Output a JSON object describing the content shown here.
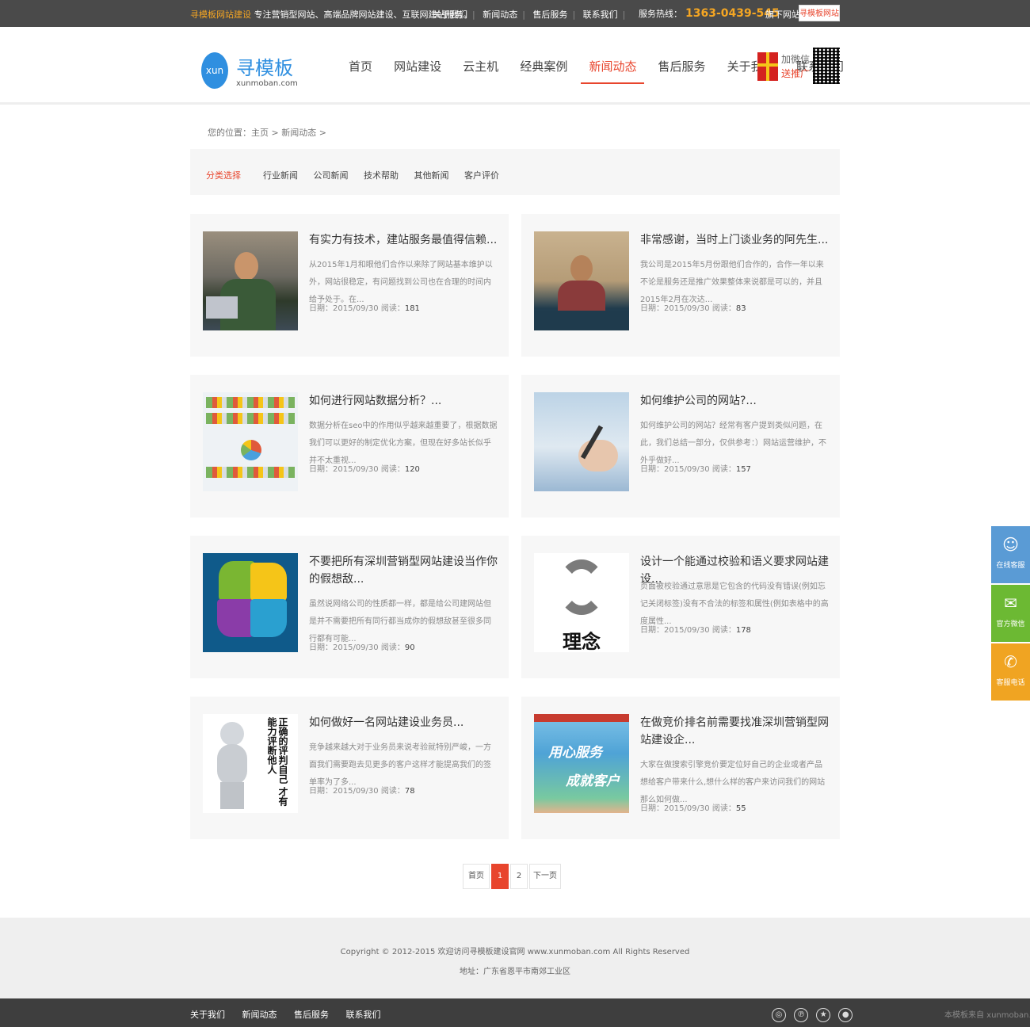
{
  "topbar": {
    "brand": "寻模板网站建设",
    "slogan": "专注营销型网站、高端品牌网站建设、互联网建站服务。",
    "links": [
      "关于我们",
      "新闻动态",
      "售后服务",
      "联系我们"
    ],
    "hotline_label": "服务热线：",
    "hotline_number": "1363-0439-545",
    "download": "旗下网站",
    "official_button": "寻模板网站"
  },
  "header": {
    "logo_circle": "xun",
    "logo_name": "寻模板",
    "logo_domain": "xunmoban.com",
    "nav": [
      "首页",
      "网站建设",
      "云主机",
      "经典案例",
      "新闻动态",
      "售后服务",
      "关于我们",
      "联系我们"
    ],
    "nav_active_index": 4,
    "promo_line1": "加微信",
    "promo_line2": "送推广"
  },
  "breadcrumb": "您的位置：主页 > 新闻动态 >",
  "categories": {
    "label": "分类选择",
    "items": [
      "行业新闻",
      "公司新闻",
      "技术帮助",
      "其他新闻",
      "客户评价"
    ]
  },
  "news": [
    {
      "title": "有实力有技术，建站服务最值得信赖...",
      "excerpt": "从2015年1月和眼他们合作以来除了网站基本维护以外，网站很稳定，有问题找到公司也在合理的时间内给予处于。在...",
      "date_label": "日期：2015/09/30 阅读：",
      "reads": "181",
      "thumb": "person-laptop"
    },
    {
      "title": "非常感谢，当时上门谈业务的阿先生...",
      "excerpt": "我公司是2015年5月份跟他们合作的，合作一年以来不论是服务还是推广效果整体来说都是可以的，并且2015年2月在次达...",
      "date_label": "日期：2015/09/30 阅读：",
      "reads": "83",
      "thumb": "boss-desk"
    },
    {
      "title": "如何进行网站数据分析？...",
      "excerpt": "数据分析在seo中的作用似乎越来越重要了，根据数据我们可以更好的制定优化方案，但现在好多站长似乎并不太重视...",
      "date_label": "日期：2015/09/30 阅读：",
      "reads": "120",
      "thumb": "dashboard"
    },
    {
      "title": "如何维护公司的网站?...",
      "excerpt": "如何维护公司的网站？经常有客户提到类似问题，在此，我们总结一部分，仅供参考：）网站运营维护，不外乎做好...",
      "date_label": "日期：2015/09/30 阅读：",
      "reads": "157",
      "thumb": "map-hand"
    },
    {
      "title": "不要把所有深圳营销型网站建设当作你的假想敌...",
      "excerpt": "虽然说网络公司的性质都一样，都是给公司建网站但是并不需要把所有同行都当成你的假想敌甚至很多同行都有可能...",
      "date_label": "日期：2015/09/30 阅读：",
      "reads": "90",
      "thumb": "puzzle"
    },
    {
      "title": "设计一个能通过校验和语义要求网站建设...",
      "excerpt": "页面被校验通过意思是它包含的代码没有错误(例如忘记关闭标签)没有不合法的标签和属性(例如表格中的高度属性...",
      "date_label": "日期：2015/09/30 阅读：",
      "reads": "178",
      "thumb": "idea",
      "thumb_text": "理念"
    },
    {
      "title": "如何做好一名网站建设业务员...",
      "excerpt": "竞争越来越大对于业务员来说考验就特别严峻，一方面我们需要跑去见更多的客户这样才能提高我们的签单率为了多...",
      "date_label": "日期：2015/09/30 阅读：",
      "reads": "78",
      "thumb": "figure",
      "thumb_text": "正确的评判自己 才有能力评断他人"
    },
    {
      "title": "在做竞价排名前需要找准深圳营销型网站建设企...",
      "excerpt": "大家在做搜索引擎竞价要定位好自己的企业或者产品想给客户带来什么,想什么样的客户来访问我们的网站 那么如何做...",
      "date_label": "日期：2015/09/30 阅读：",
      "reads": "55",
      "thumb": "service",
      "thumb_text_1": "用心服务",
      "thumb_text_2": "成就客户"
    }
  ],
  "pagination": {
    "first": "首页",
    "pages": [
      "1",
      "2"
    ],
    "current": "1",
    "next": "下一页"
  },
  "footer": {
    "copyright": "Copyright © 2012-2015 欢迎访问寻模板建设官网 www.xunmoban.com All Rights Reserved",
    "address": "地址：广东省恩平市南郊工业区",
    "links": [
      "关于我们",
      "新闻动态",
      "售后服务",
      "联系我们"
    ],
    "social_icons": [
      "weibo-icon",
      "pinterest-icon",
      "star-icon",
      "location-icon"
    ],
    "credit": "本模板来自 xunmoban.com"
  },
  "side_service": [
    {
      "label": "在线客服",
      "icon": "qq-icon",
      "color": "#5a9bd5"
    },
    {
      "label": "官方微信",
      "icon": "wechat-icon",
      "color": "#6cb933"
    },
    {
      "label": "客服电话",
      "icon": "phone-icon",
      "color": "#f0a422"
    }
  ],
  "colors": {
    "accent": "#e8452d",
    "topbar": "#4a4a4a",
    "hotline": "#f5a623"
  }
}
